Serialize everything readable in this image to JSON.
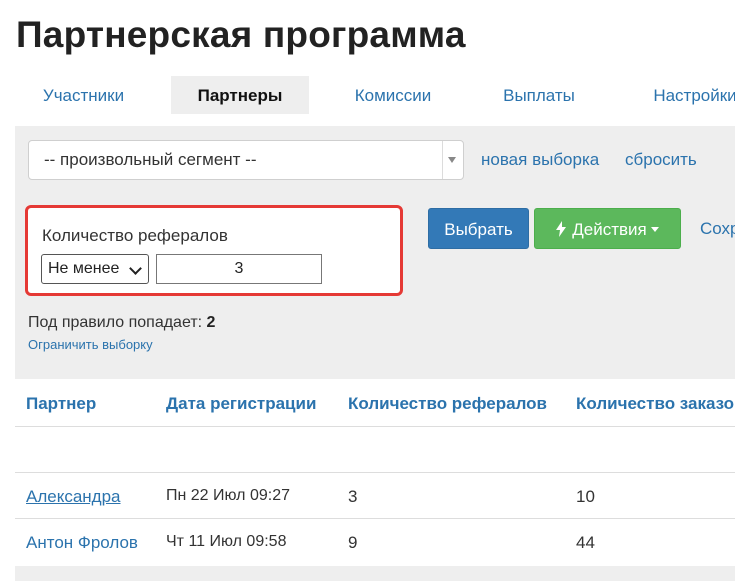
{
  "page": {
    "title": "Партнерская программа"
  },
  "tabs": [
    {
      "label": "Участники",
      "active": false
    },
    {
      "label": "Партнеры",
      "active": true
    },
    {
      "label": "Комиссии",
      "active": false
    },
    {
      "label": "Выплаты",
      "active": false
    },
    {
      "label": "Настройки",
      "active": false
    }
  ],
  "segment": {
    "selected": "-- произвольный сегмент --",
    "new_selection_link": "новая выборка",
    "reset_link": "сбросить"
  },
  "filter": {
    "label": "Количество рефералов",
    "operator": "Не менее",
    "value": "3"
  },
  "actions": {
    "select_button": "Выбрать",
    "actions_button": "Действия",
    "save_link": "Сохр"
  },
  "result": {
    "count_label": "Под правило попадает:",
    "count_value": "2",
    "limit_link": "Ограничить выборку"
  },
  "table": {
    "columns": [
      "Партнер",
      "Дата регистрации",
      "Количество рефералов",
      "Количество заказо"
    ],
    "rows": [
      {
        "partner": "Александра",
        "date": "Пн 22 Июл 09:27",
        "referrals": "3",
        "orders": "10"
      },
      {
        "partner": "Антон Фролов",
        "date": "Чт 11 Июл 09:58",
        "referrals": "9",
        "orders": "44"
      }
    ]
  },
  "colors": {
    "link": "#2b73ad",
    "primary": "#3379b7",
    "success": "#5cb85c",
    "highlight": "#e53935"
  },
  "icons": {
    "actions": "bolt-icon",
    "actions_caret": "caret-down-icon",
    "select_caret": "triangle-down-icon"
  }
}
